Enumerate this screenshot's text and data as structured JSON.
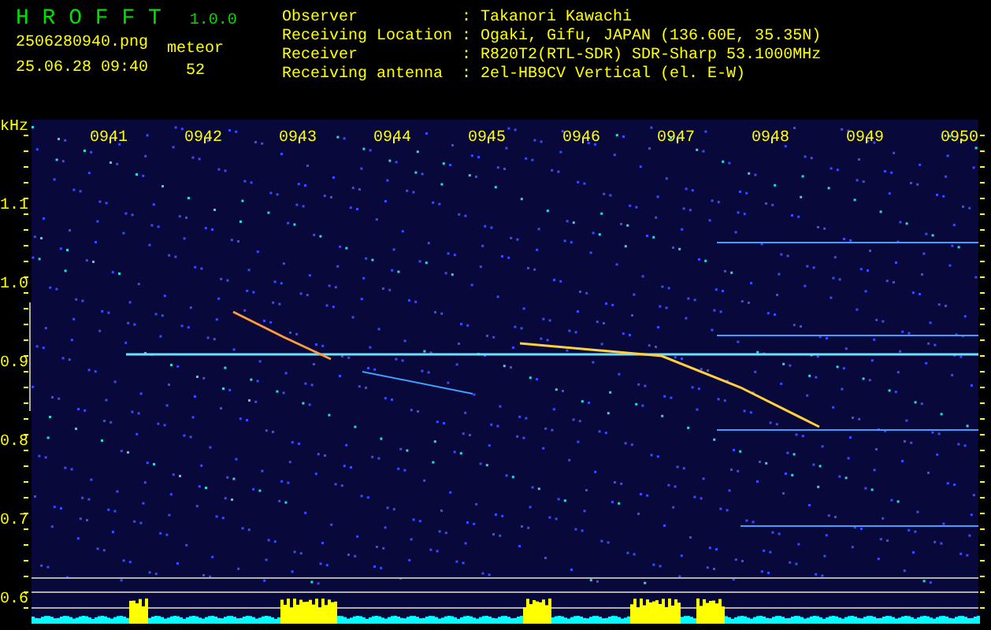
{
  "app": {
    "title": "H R O F F T",
    "version": "1.0.0"
  },
  "file": {
    "name": "2506280940.png",
    "datetime": "25.06.28 09:40"
  },
  "count": {
    "label": "meteor",
    "value": "52"
  },
  "info": [
    {
      "label": "Observer",
      "value": ": Takanori Kawachi"
    },
    {
      "label": "Receiving Location",
      "value": ": Ogaki, Gifu, JAPAN (136.60E, 35.35N)"
    },
    {
      "label": "Receiver",
      "value": ": R820T2(RTL-SDR) SDR-Sharp 53.1000MHz"
    },
    {
      "label": "Receiving antenna",
      "value": ": 2el-HB9CV Vertical (el. E-W)"
    }
  ],
  "freq_axis": {
    "unit": "kHz",
    "labels": [
      "1.1",
      "1.0",
      "0.9",
      "0.8",
      "0.7",
      "0.6"
    ]
  },
  "time_axis": {
    "labels": [
      "0941",
      "0942",
      "0943",
      "0944",
      "0945",
      "0946",
      "0947",
      "0948",
      "0949",
      "0950"
    ]
  }
}
